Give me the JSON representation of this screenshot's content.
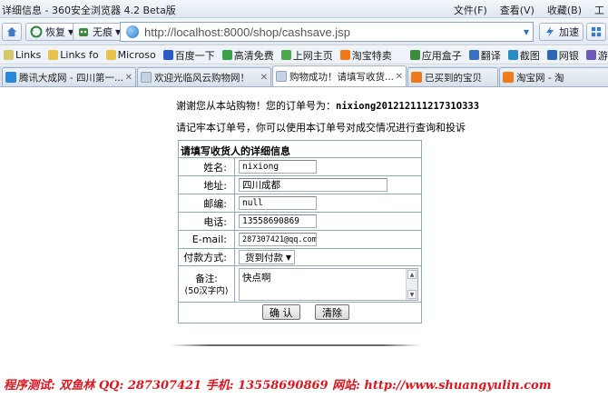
{
  "window": {
    "title": "详细信息 - 360安全浏览器 4.2 Beta版",
    "menu": [
      "文件(F)",
      "查看(V)",
      "收藏(B)",
      "工"
    ]
  },
  "toolbar": {
    "home_label": "",
    "restore_label": "恢复",
    "noads_label": "无痕",
    "url": "http://localhost:8000/shop/cashsave.jsp",
    "accelerate_label": "加速"
  },
  "bookmarks": [
    {
      "label": "Links",
      "icon": "link-icon"
    },
    {
      "label": "Links fo",
      "icon": "folder-icon"
    },
    {
      "label": "Microso",
      "icon": "folder-icon"
    },
    {
      "label": "百度一下",
      "icon": "baidu-icon"
    },
    {
      "label": "高清免费",
      "icon": "video-icon"
    },
    {
      "label": "上网主页",
      "icon": "home-icon"
    },
    {
      "label": "淘宝特卖",
      "icon": "taobao-icon"
    },
    {
      "label": "应用盒子",
      "icon": "app-box-icon"
    },
    {
      "label": "翻译",
      "icon": "translate-icon"
    },
    {
      "label": "截图",
      "icon": "screenshot-icon"
    },
    {
      "label": "网银",
      "icon": "bank-icon"
    },
    {
      "label": "游戏",
      "icon": "game-icon"
    }
  ],
  "tabs": [
    {
      "label": "腾讯大成网 - 四川第一...",
      "active": false
    },
    {
      "label": "欢迎光临风云购物网！",
      "active": false
    },
    {
      "label": "购物成功！请填写收货...",
      "active": true
    },
    {
      "label": "已买到的宝贝",
      "active": false
    },
    {
      "label": "淘宝网 - 淘",
      "active": false
    }
  ],
  "page": {
    "thanks_text": "谢谢您从本站购物！您的订单号为：",
    "order_no": "nixiong20121211121731O333",
    "remember_text": "请记牢本订单号，你可以使用本订单号对成交情况进行查询和投诉",
    "form_title": "请填写收货人的详细信息",
    "fields": {
      "name": {
        "label": "姓名:",
        "value": "nixiong"
      },
      "address": {
        "label": "地址:",
        "value": "四川成都"
      },
      "postcode": {
        "label": "邮编:",
        "value": "null"
      },
      "phone": {
        "label": "电话:",
        "value": "13558690869"
      },
      "email": {
        "label": "E-mail:",
        "value": "287307421@qq.com"
      },
      "payment": {
        "label": "付款方式:",
        "value": "货到付款"
      },
      "remark": {
        "label": "备注:",
        "sub_label": "(50汉字内)",
        "value": "快点啊"
      }
    },
    "confirm_label": "确 认",
    "clear_label": "清除"
  },
  "footer": "程序测试: 双鱼林   QQ: 287307421   手机: 13558690869   网站: http://www.shuangyulin.com"
}
